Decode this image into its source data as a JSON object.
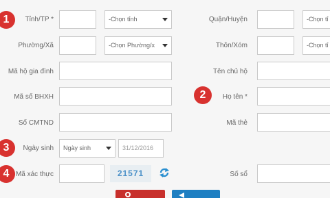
{
  "form": {
    "province": {
      "label": "Tỉnh/TP *",
      "select": "-Chọn tỉnh"
    },
    "district": {
      "label": "Quận/Huyện",
      "select": "-Chọn tỉ"
    },
    "ward": {
      "label": "Phường/Xã",
      "select": "-Chọn Phường/x"
    },
    "village": {
      "label": "Thôn/Xóm",
      "select": "-Chọn tỉ"
    },
    "household_code": {
      "label": "Mã hộ gia đình"
    },
    "household_head": {
      "label": "Tên chủ hộ"
    },
    "bhxh_code": {
      "label": "Mã số BHXH"
    },
    "full_name": {
      "label": "Họ tên *"
    },
    "id_card": {
      "label": "Số CMTND"
    },
    "card_code": {
      "label": "Mã thẻ"
    },
    "birth": {
      "label": "Ngày sinh",
      "select": "Ngày sinh",
      "value": "31/12/2016"
    },
    "verify": {
      "label": "Mã xác thực",
      "captcha": "21571"
    },
    "book_no": {
      "label": "Số sổ"
    }
  },
  "badges": [
    "1",
    "2",
    "3",
    "4"
  ],
  "icons": {
    "refresh": "refresh-icon"
  },
  "colors": {
    "badge": "#d8322f",
    "search_button": "#c8302c",
    "reset_button": "#1e7fc2",
    "captcha_text": "#4a90c8"
  }
}
